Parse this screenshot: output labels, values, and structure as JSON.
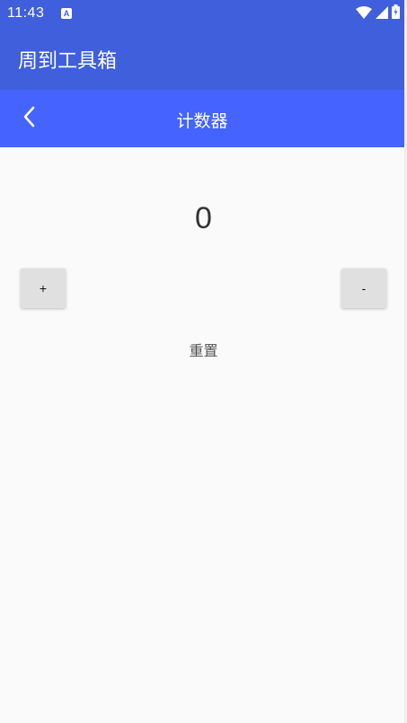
{
  "status_bar": {
    "time": "11:43",
    "notification_icon": "a-letter-icon",
    "icons": [
      "wifi-icon",
      "signal-icon",
      "battery-charging-icon"
    ]
  },
  "app_bar": {
    "title": "周到工具箱"
  },
  "nav_bar": {
    "back_icon": "chevron-left-icon",
    "title": "计数器"
  },
  "counter": {
    "value": "0",
    "increment_label": "+",
    "decrement_label": "-",
    "reset_label": "重置"
  },
  "colors": {
    "app_bar": "#3f5fdc",
    "nav_bar": "#4463ff",
    "background": "#fafafa",
    "button": "#e0e0e0"
  }
}
